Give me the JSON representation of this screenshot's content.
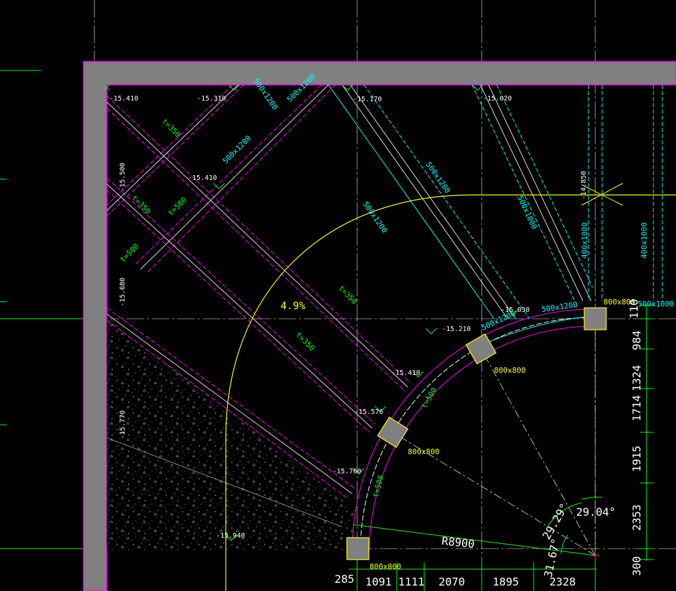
{
  "colors": {
    "background": "#000000",
    "wall": "#808080",
    "wall_outline": "#ff00ff",
    "beam_cyan": "#00ffff",
    "beam_magenta": "#ff00ff",
    "slope_line": "#ffff00",
    "dimension": "#00ff00",
    "grid": "#ffffff"
  },
  "elevations": {
    "e1": "-15.410",
    "e2": "-15.310",
    "e3": "-15.170",
    "e4": "-15.020",
    "e5": "-15.410",
    "e6": "-15.500",
    "e7": "-15.680",
    "e8": "-14.850",
    "e9": "-15.030",
    "e10": "-15.210",
    "e11": "-15.410",
    "e12": "-15.576",
    "e13": "-15.760",
    "e14": "-15.770",
    "e15": "-15.940"
  },
  "beams": {
    "b1": "500x1200",
    "b2": "500x1200",
    "b3": "500x1200",
    "b4": "500x1200",
    "b5": "500x1200",
    "b6": "500x1000",
    "b7": "400x1000",
    "b8": "400x1000",
    "b9": "500x1200",
    "b10": "500x1200",
    "b11": "500x1000"
  },
  "slabs": {
    "s1": "t=350",
    "s2": "t=350",
    "s3": "t=500",
    "s4": "t=500",
    "s5": "t=350",
    "s6": "t=350",
    "s7": "t=500",
    "s8": "t=500"
  },
  "columns": {
    "c1": "800x800",
    "c2": "800x800",
    "c3": "800x800",
    "c4": "800x800"
  },
  "slope": "4.9%",
  "radius": "R8900",
  "angles": {
    "a1": "29.29°",
    "a2": "29.04°",
    "a3": "31.67°"
  },
  "dims_right": [
    "110",
    "984",
    "1324",
    "1714",
    "1915",
    "2353",
    "300"
  ],
  "dims_bottom": [
    "285",
    "1091",
    "1111",
    "2070",
    "1895",
    "2328"
  ]
}
